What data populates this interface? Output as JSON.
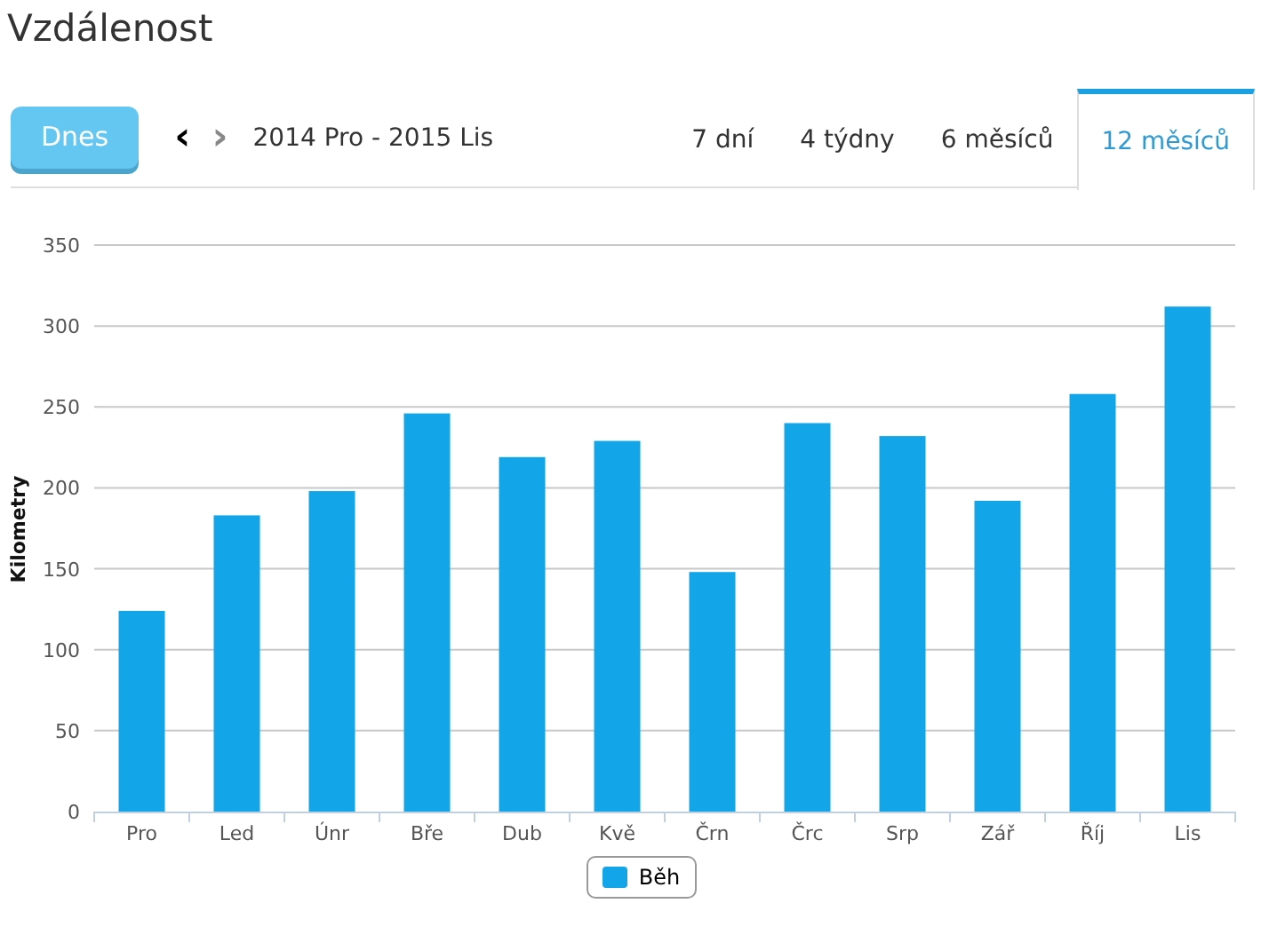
{
  "title": "Vzdálenost",
  "toolbar": {
    "today_button": "Dnes",
    "prev": "‹",
    "next": "›",
    "range": "2014 Pro - 2015 Lis"
  },
  "tabs": [
    {
      "label": "7 dní",
      "selected": false
    },
    {
      "label": "4 týdny",
      "selected": false
    },
    {
      "label": "6 měsíců",
      "selected": false
    },
    {
      "label": "12 měsíců",
      "selected": true
    }
  ],
  "chart_data": {
    "type": "bar",
    "ylabel": "Kilometry",
    "categories": [
      "Pro",
      "Led",
      "Únr",
      "Bře",
      "Dub",
      "Kvě",
      "Črn",
      "Črc",
      "Srp",
      "Zář",
      "Říj",
      "Lis"
    ],
    "series": [
      {
        "name": "Běh",
        "color": "#12a5e8",
        "values": [
          124,
          183,
          198,
          246,
          219,
          229,
          148,
          240,
          232,
          192,
          258,
          312
        ]
      }
    ],
    "ylim": [
      0,
      350
    ],
    "grid": true,
    "yticks": [
      0,
      50,
      100,
      150,
      200,
      250,
      300,
      350
    ]
  }
}
